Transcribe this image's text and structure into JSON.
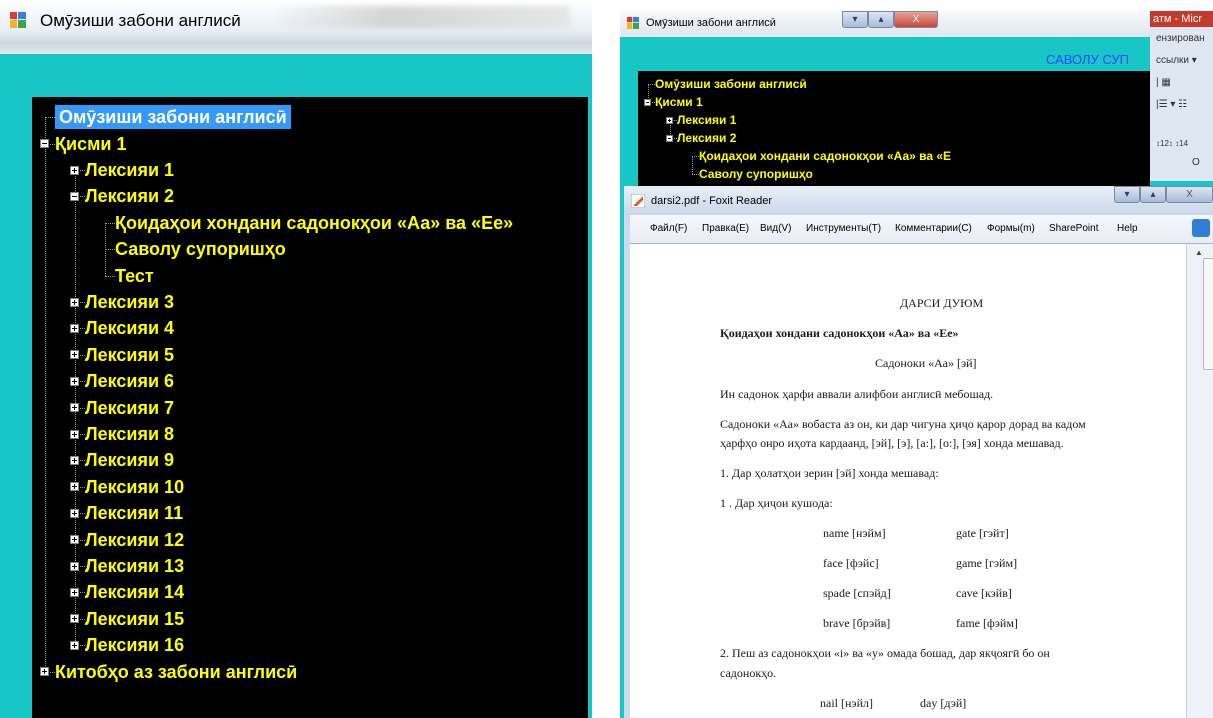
{
  "left_window": {
    "title": "Омӯзиши забони англисӣ",
    "tree": [
      {
        "label": "Омӯзиши забони англисӣ",
        "level": 0,
        "box": "none",
        "selected": true
      },
      {
        "label": "Қисми 1",
        "level": 0,
        "box": "minus"
      },
      {
        "label": "Лексияи 1",
        "level": 1,
        "box": "plus"
      },
      {
        "label": "Лексияи 2",
        "level": 1,
        "box": "minus"
      },
      {
        "label": "Қоидаҳои хондани садонокҳои «Аа» ва «Ее»",
        "level": 2,
        "box": "none"
      },
      {
        "label": "Саволу супоришҳо",
        "level": 2,
        "box": "none"
      },
      {
        "label": "Тест",
        "level": 2,
        "box": "none"
      },
      {
        "label": "Лексияи 3",
        "level": 1,
        "box": "plus"
      },
      {
        "label": "Лексияи 4",
        "level": 1,
        "box": "plus"
      },
      {
        "label": "Лексияи 5",
        "level": 1,
        "box": "plus"
      },
      {
        "label": "Лексияи 6",
        "level": 1,
        "box": "plus"
      },
      {
        "label": "Лексияи 7",
        "level": 1,
        "box": "plus"
      },
      {
        "label": "Лексияи 8",
        "level": 1,
        "box": "plus"
      },
      {
        "label": "Лексияи 9",
        "level": 1,
        "box": "plus"
      },
      {
        "label": "Лексияи 10",
        "level": 1,
        "box": "plus"
      },
      {
        "label": "Лексияи 11",
        "level": 1,
        "box": "plus"
      },
      {
        "label": "Лексияи 12",
        "level": 1,
        "box": "plus"
      },
      {
        "label": "Лексияи 13",
        "level": 1,
        "box": "plus"
      },
      {
        "label": "Лексияи 14",
        "level": 1,
        "box": "plus"
      },
      {
        "label": "Лексияи 15",
        "level": 1,
        "box": "plus"
      },
      {
        "label": "Лексияи 16",
        "level": 1,
        "box": "plus"
      },
      {
        "label": "Китобҳо аз забони англисӣ",
        "level": 0,
        "box": "plus"
      }
    ]
  },
  "right_window": {
    "title": "Омӯзиши забони англисӣ",
    "header_text": "САВОЛУ СУП",
    "tree": [
      {
        "label": "Омӯзиши забони англисӣ",
        "level": 0,
        "box": "none"
      },
      {
        "label": "Қисми 1",
        "level": 0,
        "box": "minus"
      },
      {
        "label": "Лексияи 1",
        "level": 1,
        "box": "plus"
      },
      {
        "label": "Лексияи 2",
        "level": 1,
        "box": "minus"
      },
      {
        "label": "Қоидаҳои хондани садонокҳои «Аа» ва «Е",
        "level": 2,
        "box": "none"
      },
      {
        "label": "Саволу супоришҳо",
        "level": 2,
        "box": "none"
      }
    ],
    "buttons": {
      "minimize": "▾",
      "maximize": "▴",
      "close": "X"
    }
  },
  "word_background": {
    "title_partial": "атм - Micr",
    "lines": [
      "ензирован",
      "ссылки ▾",
      "| ▦ ",
      "|☰ ▾ ☷",
      "↕12↕ ↕14",
      "О"
    ]
  },
  "foxit": {
    "title": "darsi2.pdf - Foxit Reader",
    "menu": [
      "Файл(F)",
      "Правка(E)",
      "Вид(V)",
      "Инструменты(T)",
      "Комментарии(C)",
      "Формы(m)",
      "SharePoint",
      "Help"
    ],
    "document": {
      "heading": "ДАРСИ ДУЮМ",
      "subheading": "Қоидаҳои хондани садонокҳои «Аа» ва «Ее»",
      "section": "Садоноки «Аа» [эй]",
      "p1": "Ин садонок ҳарфи аввали алифбои англисӣ мебошад.",
      "p2a": "Садоноки «Аа» вобаста аз он, ки дар чигуна ҳиҷо қарор дорад ва кадом",
      "p2b": "ҳарфҳо онро иҳота кардаанд, [эй], [э], [a:], [o:], [эя] хонда мешавад.",
      "p3": "1. Дар ҳолатҳои зерин [эй] хонда мешавад:",
      "p4": "1 . Дар ҳиҷои кушода:",
      "words": [
        [
          "name [нэйм]",
          "gate [гэйт]"
        ],
        [
          "face [фэйс]",
          "game [гэйм]"
        ],
        [
          "spade [спэйд]",
          "cave [кэйв]"
        ],
        [
          "brave [брэйв]",
          "fame [фэйм]"
        ]
      ],
      "p5a": "2. Пеш аз садонокҳои «i» ва «y» омада бошад, дар якҷоягӣ бо он",
      "p5b": "садонокҳо.",
      "words2": [
        "nail [нэйл]",
        "day [дэй]"
      ]
    }
  }
}
